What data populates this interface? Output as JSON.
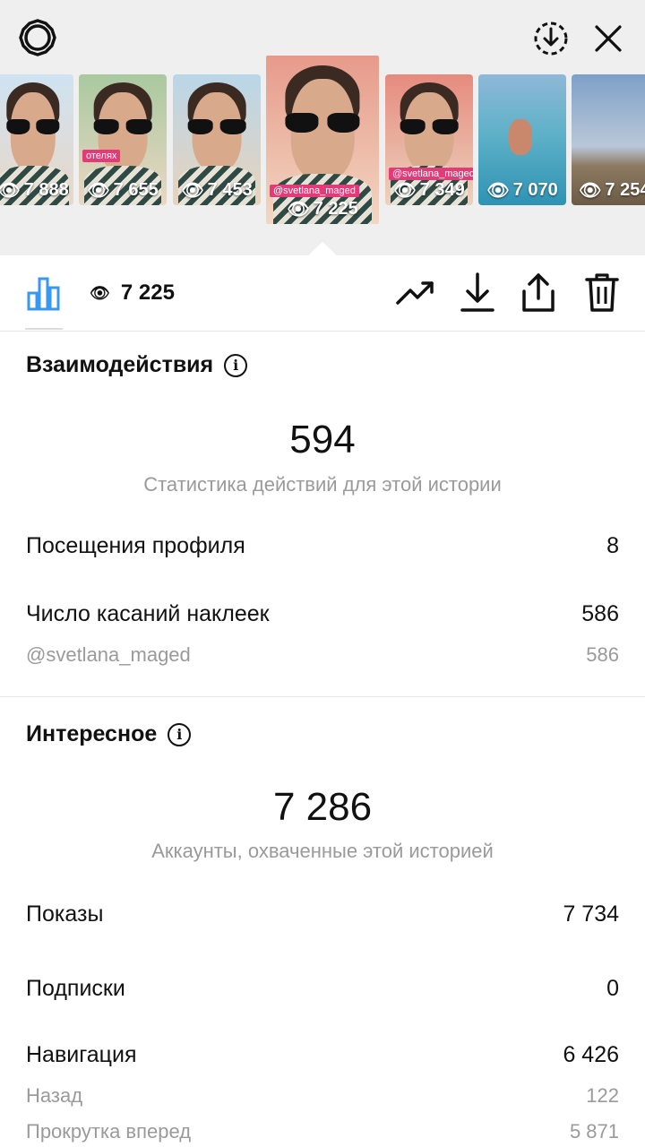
{
  "accent_color": "#3897f0",
  "header": {
    "settings_icon": "gear-icon",
    "download_icon": "download-circle-icon",
    "close_icon": "close-icon"
  },
  "thumbnails": [
    {
      "views": "7 888"
    },
    {
      "views": "7 655",
      "tag": "отелях"
    },
    {
      "views": "7 453"
    },
    {
      "views": "7 225",
      "tag": "@svetlana_maged",
      "selected": true
    },
    {
      "views": "7 349",
      "tag": "@svetlana_maged"
    },
    {
      "views": "7 070"
    },
    {
      "views": "7 254"
    }
  ],
  "toolbar": {
    "insights_icon": "bar-chart-icon",
    "views_icon": "eye-icon",
    "views_count": "7 225",
    "promote_icon": "trending-up-icon",
    "save_icon": "download-icon",
    "share_icon": "share-icon",
    "delete_icon": "trash-icon"
  },
  "interactions": {
    "title": "Взаимодействия",
    "total": "594",
    "caption": "Статистика действий для этой истории",
    "rows": [
      {
        "label": "Посещения профиля",
        "value": "8"
      },
      {
        "label": "Число касаний наклеек",
        "value": "586"
      }
    ],
    "sub_rows": [
      {
        "label": "@svetlana_maged",
        "value": "586"
      }
    ]
  },
  "discovery": {
    "title": "Интересное",
    "total": "7 286",
    "caption": "Аккаунты, охваченные этой историей",
    "rows": [
      {
        "label": "Показы",
        "value": "7 734"
      },
      {
        "label": "Подписки",
        "value": "0"
      },
      {
        "label": "Навигация",
        "value": "6 426"
      }
    ],
    "sub_rows": [
      {
        "label": "Назад",
        "value": "122"
      },
      {
        "label": "Прокрутка вперед",
        "value": "5 871"
      }
    ]
  }
}
